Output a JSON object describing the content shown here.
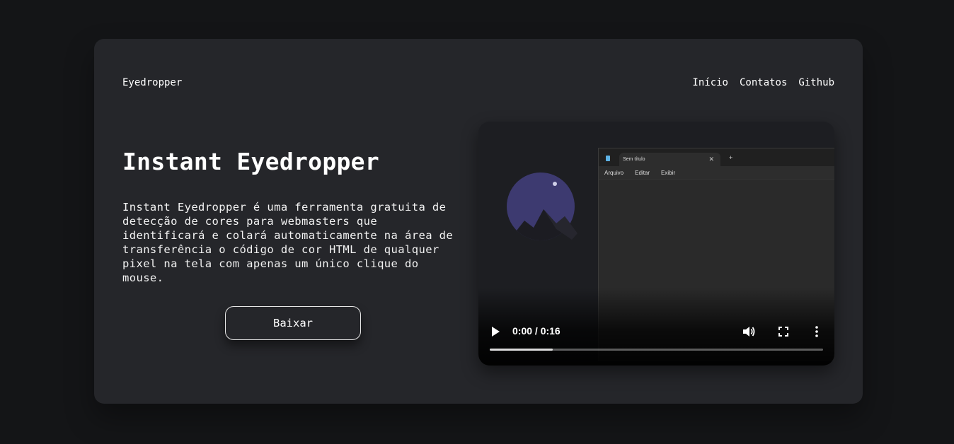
{
  "brand": "Eyedropper",
  "nav": [
    {
      "label": "Início"
    },
    {
      "label": "Contatos"
    },
    {
      "label": "Github"
    }
  ],
  "hero": {
    "title": "Instant Eyedropper",
    "description": "Instant Eyedropper é uma ferramenta gratuita de detecção de cores para webmasters que identificará e colará automaticamente na área de transferência o código de cor HTML de qualquer pixel na tela com apenas um único clique do mouse.",
    "button_label": "Baixar"
  },
  "video": {
    "app": {
      "tab_title": "Sem título",
      "menu": [
        "Arquivo",
        "Editar",
        "Exibir"
      ]
    },
    "time": "0:00 / 0:16",
    "progress": 0.19,
    "icons": [
      "play-icon",
      "volume-icon",
      "fullscreen-icon",
      "more-options-icon"
    ]
  },
  "colors": {
    "page_bg": "#141517",
    "card_bg": "#25262a",
    "moon": "#3d3a70"
  }
}
